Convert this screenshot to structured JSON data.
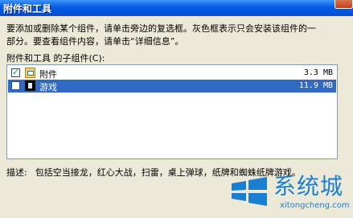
{
  "window": {
    "title": "附件和工具"
  },
  "instructions": {
    "line1": "要添加或删除某个组件，请单击旁边的复选框。灰色框表示只会安装该组件的一",
    "line2": "部分。要查看组件内容，请单击“详细信息”。"
  },
  "components": {
    "label": "附件和工具 的子组件(C):",
    "items": [
      {
        "name": "附件",
        "size": "3.3 MB",
        "checked": true,
        "icon": "folder-icon",
        "selected": false
      },
      {
        "name": "游戏",
        "size": "11.9 MB",
        "checked": false,
        "icon": "game-icon",
        "selected": true
      }
    ]
  },
  "description": {
    "label": "描述:",
    "text": "包括空当接龙，红心大战，扫雷，桌上弹球，纸牌和蜘蛛纸牌游戏。"
  },
  "watermark": {
    "brand": "系统城",
    "url": "xitongcheng.com"
  },
  "colors": {
    "titlebar": "#0054e3",
    "selection": "#316ac5",
    "dialog_bg": "#ece9d8",
    "watermark": "#1a7fd0"
  }
}
